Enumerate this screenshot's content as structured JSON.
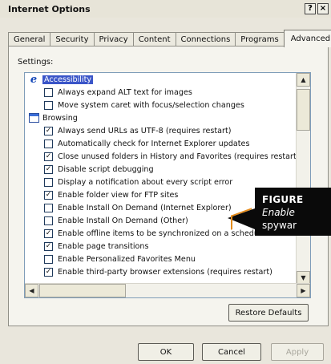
{
  "window": {
    "title": "Internet Options",
    "help_button": "?",
    "close_button": "×"
  },
  "tabs": [
    {
      "label": "General",
      "active": false
    },
    {
      "label": "Security",
      "active": false
    },
    {
      "label": "Privacy",
      "active": false
    },
    {
      "label": "Content",
      "active": false
    },
    {
      "label": "Connections",
      "active": false
    },
    {
      "label": "Programs",
      "active": false
    },
    {
      "label": "Advanced",
      "active": true
    }
  ],
  "settings_label": "Settings:",
  "settings_list": [
    {
      "type": "category",
      "icon": "internet-explorer-icon",
      "label": "Accessibility",
      "selected": true
    },
    {
      "type": "item",
      "checked": false,
      "label": "Always expand ALT text for images"
    },
    {
      "type": "item",
      "checked": false,
      "label": "Move system caret with focus/selection changes"
    },
    {
      "type": "category",
      "icon": "browser-window-icon",
      "label": "Browsing",
      "selected": false
    },
    {
      "type": "item",
      "checked": true,
      "label": "Always send URLs as UTF-8 (requires restart)"
    },
    {
      "type": "item",
      "checked": false,
      "label": "Automatically check for Internet Explorer updates"
    },
    {
      "type": "item",
      "checked": true,
      "label": "Close unused folders in History and Favorites (requires restart)"
    },
    {
      "type": "item",
      "checked": true,
      "label": "Disable script debugging"
    },
    {
      "type": "item",
      "checked": false,
      "label": "Display a notification about every script error"
    },
    {
      "type": "item",
      "checked": true,
      "label": "Enable folder view for FTP sites"
    },
    {
      "type": "item",
      "checked": false,
      "label": "Enable Install On Demand (Internet Explorer)"
    },
    {
      "type": "item",
      "checked": false,
      "label": "Enable Install On Demand (Other)"
    },
    {
      "type": "item",
      "checked": true,
      "label": "Enable offline items to be synchronized on a schedule"
    },
    {
      "type": "item",
      "checked": true,
      "label": "Enable page transitions"
    },
    {
      "type": "item",
      "checked": false,
      "label": "Enable Personalized Favorites Menu"
    },
    {
      "type": "item",
      "checked": true,
      "label": "Enable third-party browser extensions (requires restart)"
    }
  ],
  "buttons": {
    "restore_defaults": "Restore Defaults",
    "ok": "OK",
    "cancel": "Cancel",
    "apply": "Apply"
  },
  "callout": {
    "label": "FIGURE",
    "line2": "Enable",
    "line3": "spywar"
  },
  "colors": {
    "highlight": "#3a55c8",
    "callout_bg": "#0a0a0a",
    "callout_accent": "#e58c1c"
  }
}
